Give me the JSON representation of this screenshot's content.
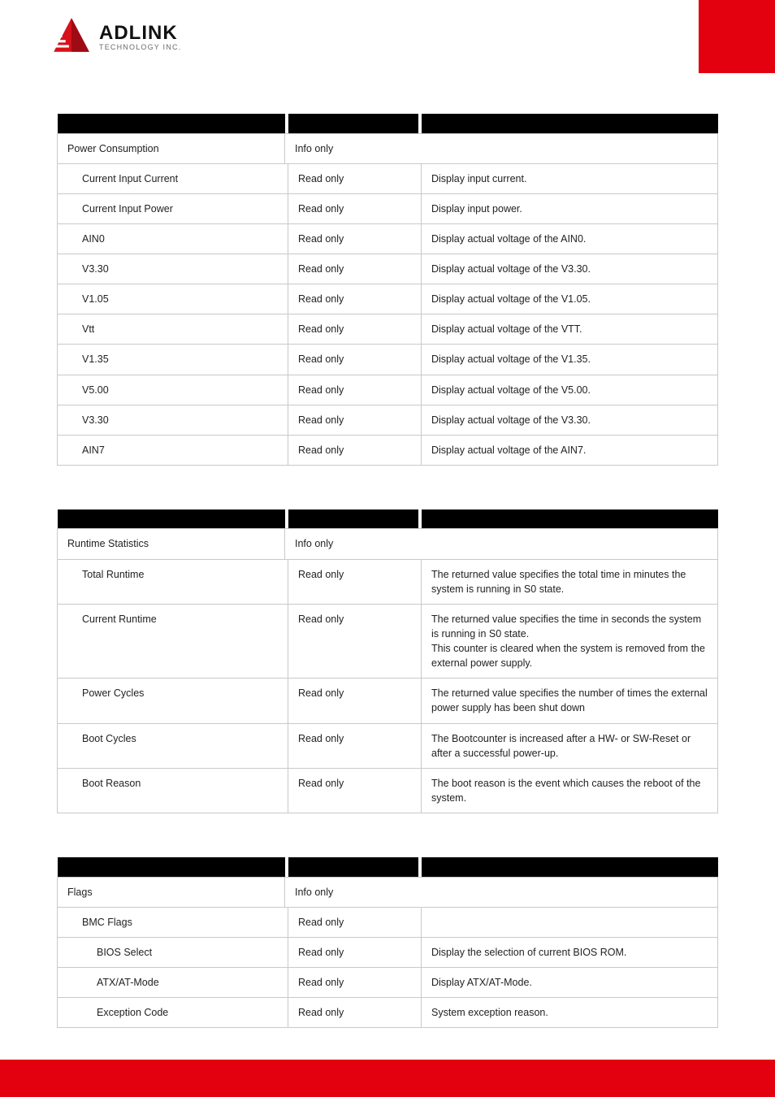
{
  "brand": {
    "name": "ADLINK",
    "sub": "TECHNOLOGY INC."
  },
  "tables": [
    {
      "header_row": {
        "feature": "Power Consumption",
        "option": "Info only",
        "description": ""
      },
      "rows": [
        {
          "feature": "Current Input Current",
          "indent": 1,
          "option": "Read only",
          "description": "Display input current."
        },
        {
          "feature": "Current Input Power",
          "indent": 1,
          "option": "Read only",
          "description": "Display input power."
        },
        {
          "feature": "AIN0",
          "indent": 1,
          "option": "Read only",
          "description": "Display actual voltage of the AIN0."
        },
        {
          "feature": "V3.30",
          "indent": 1,
          "option": "Read only",
          "description": "Display actual voltage of the V3.30."
        },
        {
          "feature": "V1.05",
          "indent": 1,
          "option": "Read only",
          "description": "Display actual voltage of the V1.05."
        },
        {
          "feature": "Vtt",
          "indent": 1,
          "option": "Read only",
          "description": "Display actual voltage of the VTT."
        },
        {
          "feature": "V1.35",
          "indent": 1,
          "option": "Read only",
          "description": "Display actual voltage of the V1.35."
        },
        {
          "feature": "V5.00",
          "indent": 1,
          "option": "Read only",
          "description": "Display actual voltage of the V5.00."
        },
        {
          "feature": "V3.30",
          "indent": 1,
          "option": "Read only",
          "description": "Display actual voltage of the V3.30."
        },
        {
          "feature": "AIN7",
          "indent": 1,
          "option": "Read only",
          "description": "Display actual voltage of the AIN7."
        }
      ]
    },
    {
      "header_row": {
        "feature": "Runtime Statistics",
        "option": "Info only",
        "description": ""
      },
      "rows": [
        {
          "feature": "Total Runtime",
          "indent": 1,
          "option": "Read only",
          "description": "The returned value specifies the total time in minutes the system is running in S0 state."
        },
        {
          "feature": "Current Runtime",
          "indent": 1,
          "option": "Read only",
          "description": "The returned value specifies the time in seconds the system is running in S0 state.\nThis counter is cleared when the system is removed from the external power supply."
        },
        {
          "feature": "Power Cycles",
          "indent": 1,
          "option": "Read only",
          "description": "The returned value specifies the number of times the external power supply has been shut down"
        },
        {
          "feature": "Boot Cycles",
          "indent": 1,
          "option": "Read only",
          "description": "The Bootcounter is increased after a HW- or SW-Reset or after a successful power-up."
        },
        {
          "feature": "Boot Reason",
          "indent": 1,
          "option": "Read only",
          "description": "The boot reason is the event which causes the reboot of the system."
        }
      ]
    },
    {
      "header_row": {
        "feature": "Flags",
        "option": "Info only",
        "description": ""
      },
      "rows": [
        {
          "feature": "BMC Flags",
          "indent": 1,
          "option": "Read only",
          "description": ""
        },
        {
          "feature": "BIOS Select",
          "indent": 2,
          "option": "Read only",
          "description": "Display the selection of current BIOS ROM."
        },
        {
          "feature": "ATX/AT-Mode",
          "indent": 2,
          "option": "Read only",
          "description": "Display ATX/AT-Mode."
        },
        {
          "feature": "Exception Code",
          "indent": 2,
          "option": "Read only",
          "description": "System exception reason."
        }
      ]
    }
  ]
}
